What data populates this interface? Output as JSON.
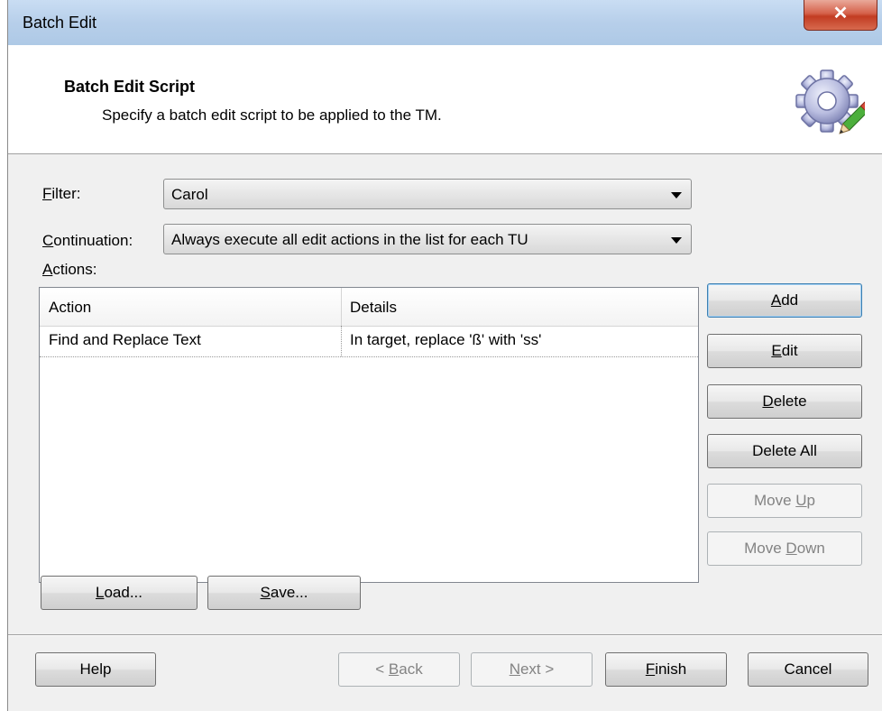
{
  "window": {
    "title": "Batch Edit",
    "close_glyph": "✕"
  },
  "header": {
    "title": "Batch Edit Script",
    "subtitle": "Specify a batch edit script to be applied to the TM.",
    "icon": "gear-pencil-icon"
  },
  "form": {
    "filter": {
      "label_u": "F",
      "label_rest": "ilter:",
      "value": "Carol"
    },
    "continuation": {
      "label_u": "C",
      "label_rest": "ontinuation:",
      "value": "Always execute all edit actions in the list for each TU"
    },
    "actions_label": {
      "label_u": "A",
      "label_rest": "ctions:"
    }
  },
  "actions_table": {
    "columns": [
      "Action",
      "Details"
    ],
    "rows": [
      {
        "action": "Find and Replace Text",
        "details": "In target, replace 'ß' with 'ss'"
      }
    ]
  },
  "side_buttons": {
    "add": {
      "u": "A",
      "rest": "dd"
    },
    "edit": {
      "u": "E",
      "rest": "dit"
    },
    "delete": {
      "u": "D",
      "rest": "elete"
    },
    "delete_all": {
      "label": "Delete All"
    },
    "move_up": {
      "pre": "Move ",
      "u": "U",
      "rest": "p"
    },
    "move_down": {
      "pre": "Move ",
      "u": "D",
      "rest": "own"
    }
  },
  "file_buttons": {
    "load": {
      "u": "L",
      "rest": "oad..."
    },
    "save": {
      "u": "S",
      "rest": "ave..."
    }
  },
  "footer": {
    "help": "Help",
    "back": {
      "pre": "< ",
      "u": "B",
      "rest": "ack"
    },
    "next": {
      "u": "N",
      "rest": "ext >"
    },
    "finish": {
      "u": "F",
      "rest": "inish"
    },
    "cancel": "Cancel"
  }
}
